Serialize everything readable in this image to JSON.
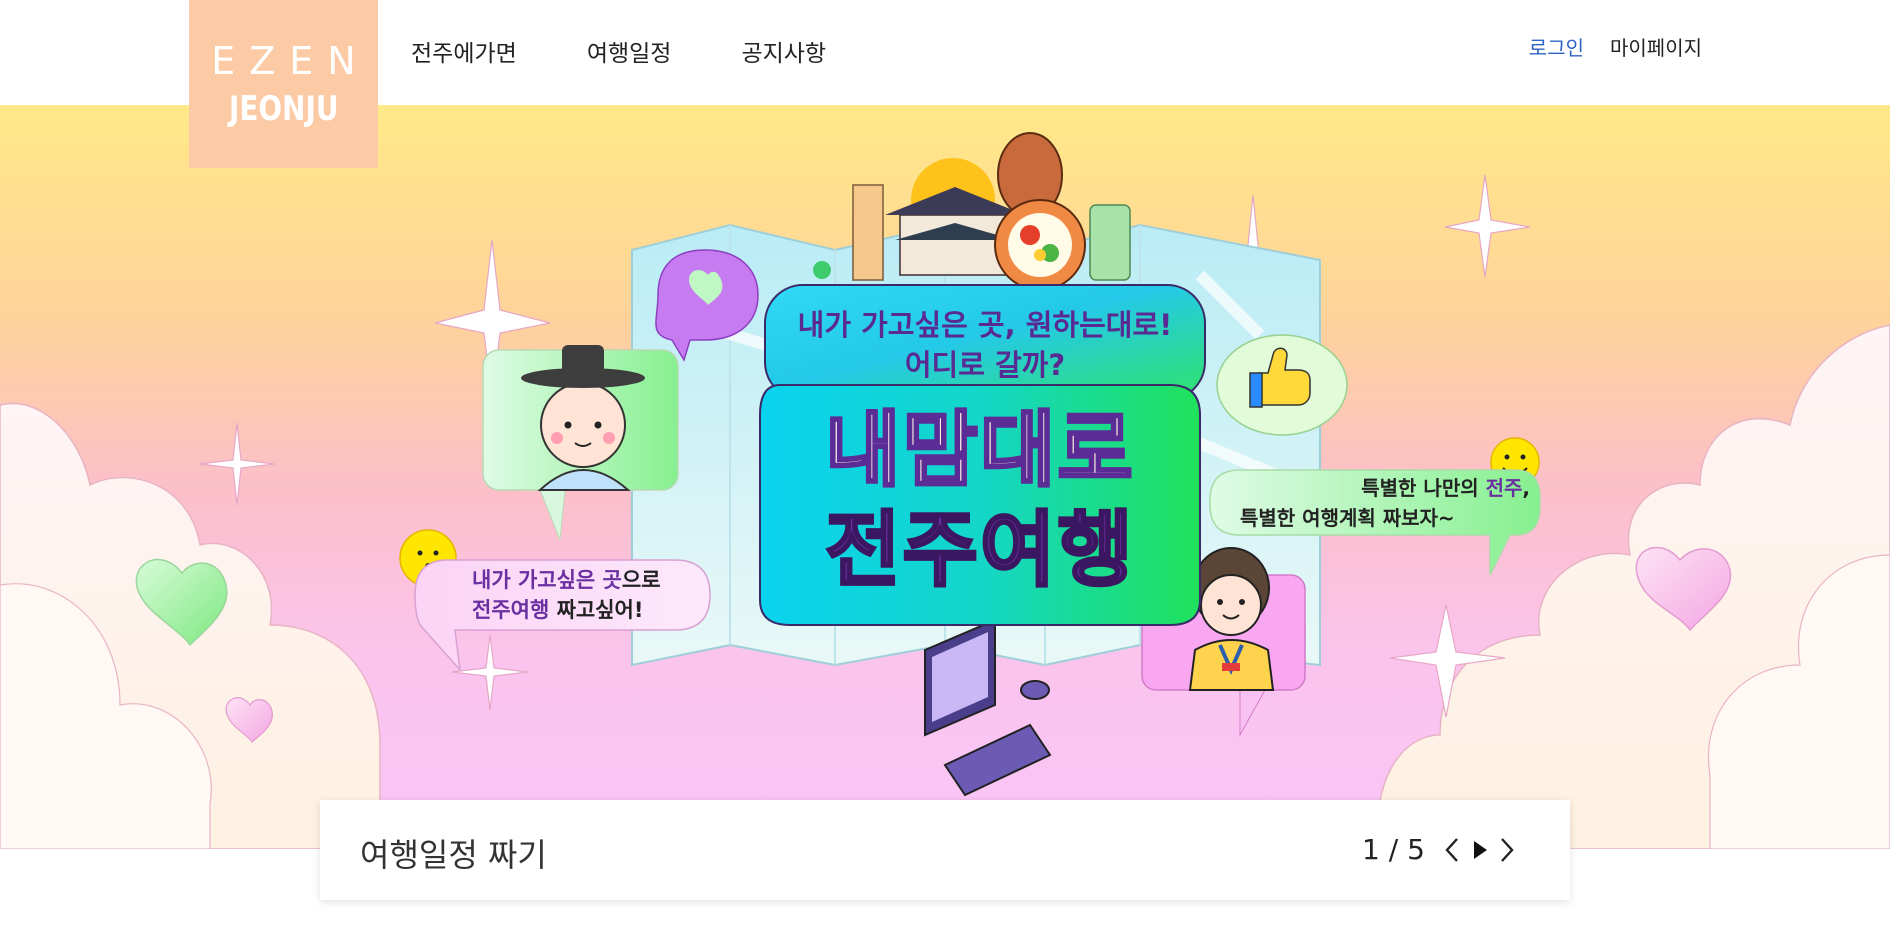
{
  "brand": {
    "line1": "EZEN",
    "line2": "JEONJU",
    "bg_color": "#fccba5"
  },
  "nav": {
    "items": [
      "전주에가면",
      "여행일정",
      "공지사항"
    ]
  },
  "util": {
    "login": "로그인",
    "mypage": "마이페이지",
    "login_color": "#2f62c5"
  },
  "banner": {
    "headline1": "내가 가고싶은 곳, 원하는대로!",
    "headline2": "어디로 갈까?",
    "title1": "내맘대로",
    "title2": "전주여행",
    "bubble_left_line1_a": "내가 가고싶은 곳",
    "bubble_left_line1_b": "으로",
    "bubble_left_line2_a": "전주여행",
    "bubble_left_line2_b": " 짜고싶어!",
    "bubble_right_line1_a": "특별한 나만의 ",
    "bubble_right_line1_b": "전주",
    "bubble_right_line1_c": ",",
    "bubble_right_line2": "특별한 여행계획 짜보자~",
    "accent_color": "#6a2fa0"
  },
  "slider": {
    "title": "여행일정 짜기",
    "current": "1",
    "separator": " / ",
    "total": "5",
    "icons": [
      "chevron-left-icon",
      "play-icon",
      "chevron-right-icon"
    ]
  }
}
